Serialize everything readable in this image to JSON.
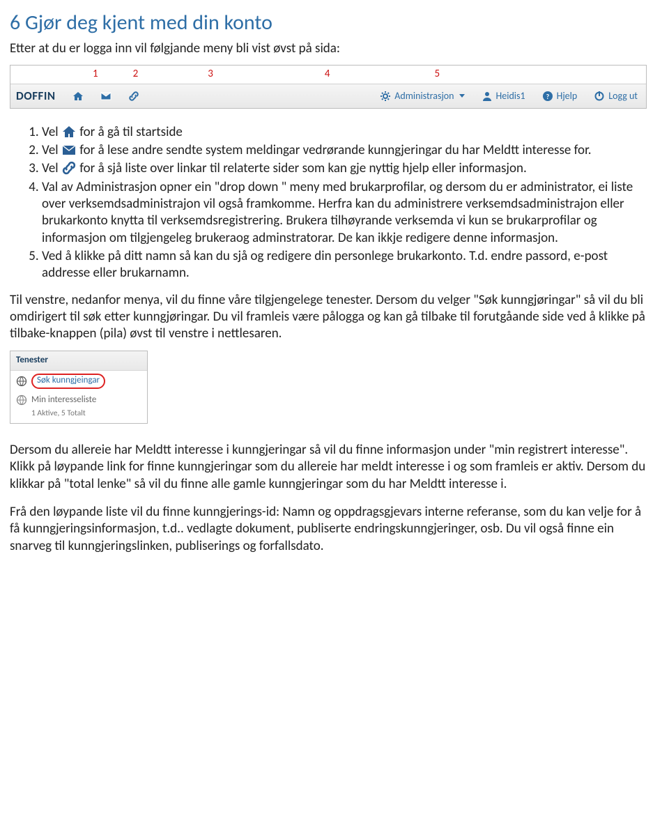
{
  "heading": "6 Gjør deg kjent med din konto",
  "intro": "Etter at du er logga inn vil følgjande meny bli vist  øvst  på sida:",
  "menu_numbers": [
    "1",
    "2",
    "3",
    "4",
    "5"
  ],
  "menubar": {
    "brand": "DOFFIN",
    "admin": "Administrasjon",
    "user": "Heidis1",
    "help": "Hjelp",
    "logout": "Logg ut"
  },
  "steps": {
    "s1a": "Vel ",
    "s1b": "  for å gå til startside",
    "s2a": "Vel ",
    "s2b": " for å lese andre sendte system meldingar vedrørande kunngjeringar du har Meldtt interesse for.",
    "s3a": "Vel ",
    "s3b": " for å  sjå  liste over linkar til relaterte sider som kan gje nyttig hjelp eller informasjon.",
    "s4": "Val av Administrasjon opner ein \"drop down \" meny med brukarprofilar, og dersom du er administrator, ei liste over verksemdsadministrajon vil også framkomme. Herfra kan du administrere verksemdsadministrajon  eller brukarkonto knytta til verksemdsregistrering. Brukera tilhøyrande verksemda vi  kun se brukarprofilar og informasjon om tilgjengeleg brukeraog adminstratorar. De kan ikkje redigere denne informasjon.",
    "s5": "Ved å klikke på ditt namn så kan du sjå og redigere din personlege brukarkonto. T.d. endre passord, e-post addresse eller brukarnamn."
  },
  "para1": "Til venstre, nedanfor menya, vil du finne våre tilgjengelege tenester. Dersom du velger \"Søk kunngjøringar\" så vil du bli omdirigert til søk etter kunngjøringar. Du vil framleis være pålogga og kan gå tilbake til forutgåande side ved å klikke på tilbake-knappen (pila) øvst  til  venstre i nettlesaren.",
  "panel": {
    "title": "Tenester",
    "row1": "Søk kunngjeingar",
    "row2": "Min interesseliste",
    "sub": "1 Aktive,  5 Totalt"
  },
  "para2": "Dersom du allereie har Meldtt interesse i kunngjeringar så vil du finne informasjon under \"min registrert interesse\". Klikk på løypande link for finne kunngjeringar som du allereie har meldt interesse i og som framleis er aktiv. Dersom du klikkar på \"total lenke\" så vil du finne alle gamle kunngjeringar som du har Meldtt interesse i.",
  "para3": "Frå den løypande liste vil du finne kunngjerings-id: Namn og oppdragsgjevars interne referanse, som du kan velje for å få kunngjeringsinformasjon, t.d.. vedlagte dokument, publiserte endringskunngjeringer, osb. Du vil også finne ein snarveg til kunngjeringslinken, publiserings og forfallsdato."
}
